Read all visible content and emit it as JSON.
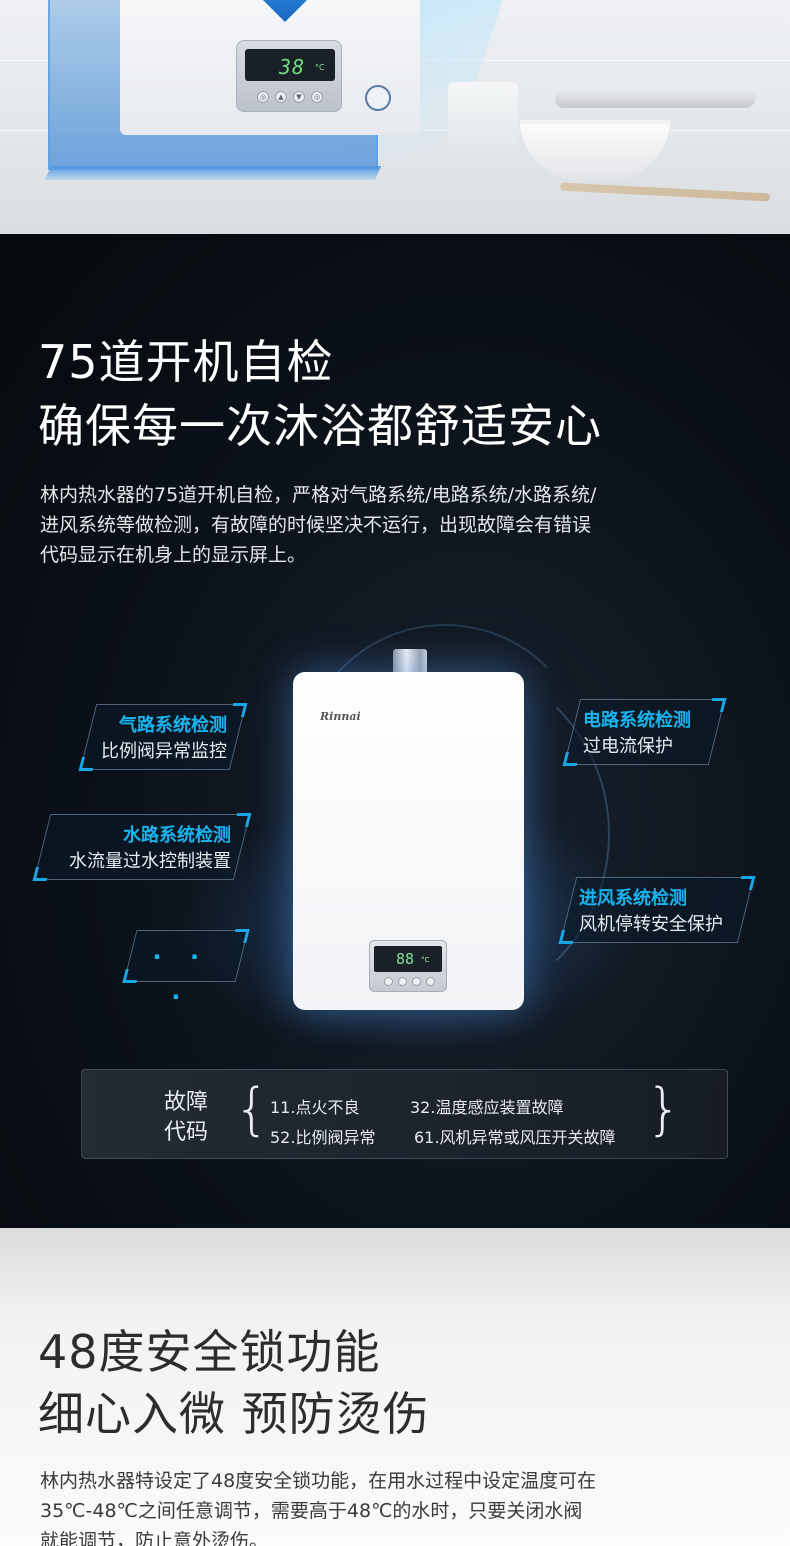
{
  "section1": {
    "display_temp": "38",
    "display_unit": "°C",
    "panel_buttons": [
      "◎",
      "▲",
      "▼",
      "◎"
    ]
  },
  "section2": {
    "title_line1": "75道开机自检",
    "title_line2": "确保每一次沐浴都舒适安心",
    "description": [
      "林内热水器的75道开机自检，严格对气路系统/电路系统/水路系统/",
      "进风系统等做检测，有故障的时候坚决不运行，出现故障会有错误",
      "代码显示在机身上的显示屏上。"
    ],
    "brand": "Rinnai",
    "display_temp": "88",
    "display_unit": "°C",
    "tags": [
      {
        "title": "气路系统检测",
        "subtitle": "比例阀异常监控"
      },
      {
        "title": "水路系统检测",
        "subtitle": "水流量过水控制装置"
      },
      {
        "title": "电路系统检测",
        "subtitle": "过电流保护"
      },
      {
        "title": "进风系统检测",
        "subtitle": "风机停转安全保护"
      }
    ],
    "more_dots": "· · ·",
    "fault": {
      "label_line1": "故障",
      "label_line2": "代码",
      "codes": [
        "11.点火不良",
        "32.温度感应装置故障",
        "52.比例阀异常",
        "61.风机异常或风压开关故障"
      ]
    },
    "accent_color": "#19b4f0"
  },
  "section3": {
    "title_line1": "48度安全锁功能",
    "title_line2": "细心入微 预防烫伤",
    "description": [
      "林内热水器特设定了48度安全锁功能，在用水过程中设定温度可在",
      "35℃-48℃之间任意调节，需要高于48℃的水时，只要关闭水阀",
      "就能调节，防止意外烫伤。"
    ]
  }
}
